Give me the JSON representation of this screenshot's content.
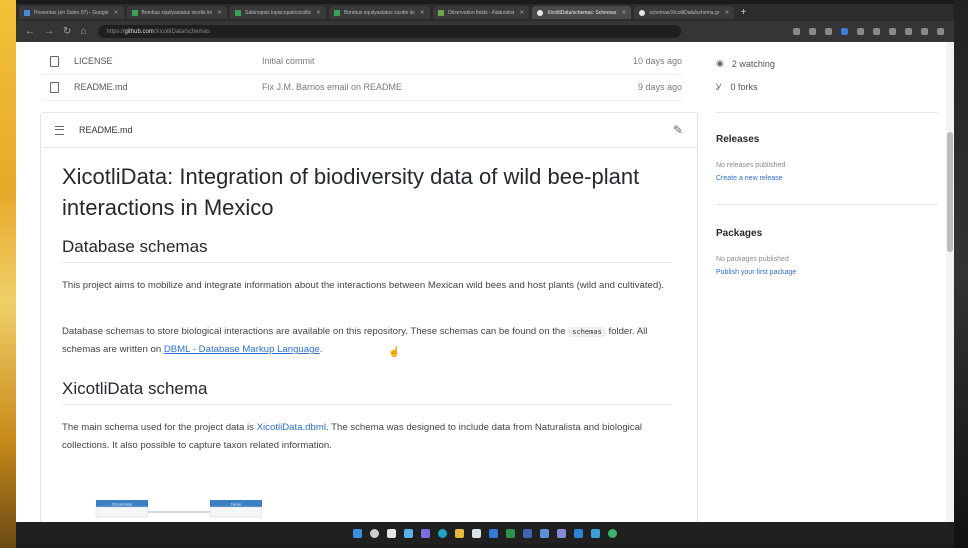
{
  "browser": {
    "tabs": [
      {
        "label": "Presentas (en Salen 07) - Google",
        "color": "#4a8ad8"
      },
      {
        "label": "Bombus xquilyastatus xicotle lio",
        "color": "#3aa05a"
      },
      {
        "label": "Sabinopsis lopiscopaticocollis",
        "color": "#3aa05a"
      },
      {
        "label": "Bombus xquilyastatus xicotle lio",
        "color": "#3aa05a"
      },
      {
        "label": "Observation fields - iNaturalist",
        "color": "#6ca64a"
      },
      {
        "label": "XicotliData/schemas: Schemas",
        "color": "#e6e6e6",
        "active": true
      },
      {
        "label": "schemas/XicotliData/schema.gr",
        "color": "#e6e6e6"
      }
    ],
    "new_tab": "+",
    "url_prefix": "https://",
    "url_host": "github.com",
    "url_path": "/XicotliData/schemas"
  },
  "files": [
    {
      "name": "LICENSE",
      "message": "Initial commit",
      "date": "10 days ago"
    },
    {
      "name": "README.md",
      "message": "Fix J.M. Barrios email on README",
      "date": "9 days ago"
    }
  ],
  "readme": {
    "header_label": "README.md",
    "title": "XicotliData: Integration of biodiversity data of wild bee-plant interactions in Mexico",
    "h_db": "Database schemas",
    "p1": "This project aims to mobilize and integrate information about the interactions between Mexican wild bees and host plants (wild and cultivated).",
    "p2_a": "Database schemas to store biological interactions are available on this repository. These schemas can be found on the",
    "p2_code": "schemas",
    "p2_b": "folder. All schemas are written on",
    "p2_link": "DBML - Database Markup Language",
    "p2_end": ".",
    "h_schema": "XicotliData schema",
    "p3_a": "The main schema used for the project data is",
    "p3_link": "XicotliData.dbml",
    "p3_b": ". The schema was designed to include data from Naturalista and biological collections. It also possible to capture taxon related information.",
    "diagram_tables": [
      "Occurrence",
      "Taxon"
    ]
  },
  "sidebar": {
    "watching": "2 watching",
    "forks": "0 forks",
    "releases_title": "Releases",
    "releases_none": "No releases published",
    "releases_link": "Create a new release",
    "packages_title": "Packages",
    "packages_none": "No packages published",
    "packages_link": "Publish your first package"
  },
  "colors": {
    "link": "#2f6fd3",
    "heading": "#24292e",
    "border": "#e1e4e8"
  }
}
